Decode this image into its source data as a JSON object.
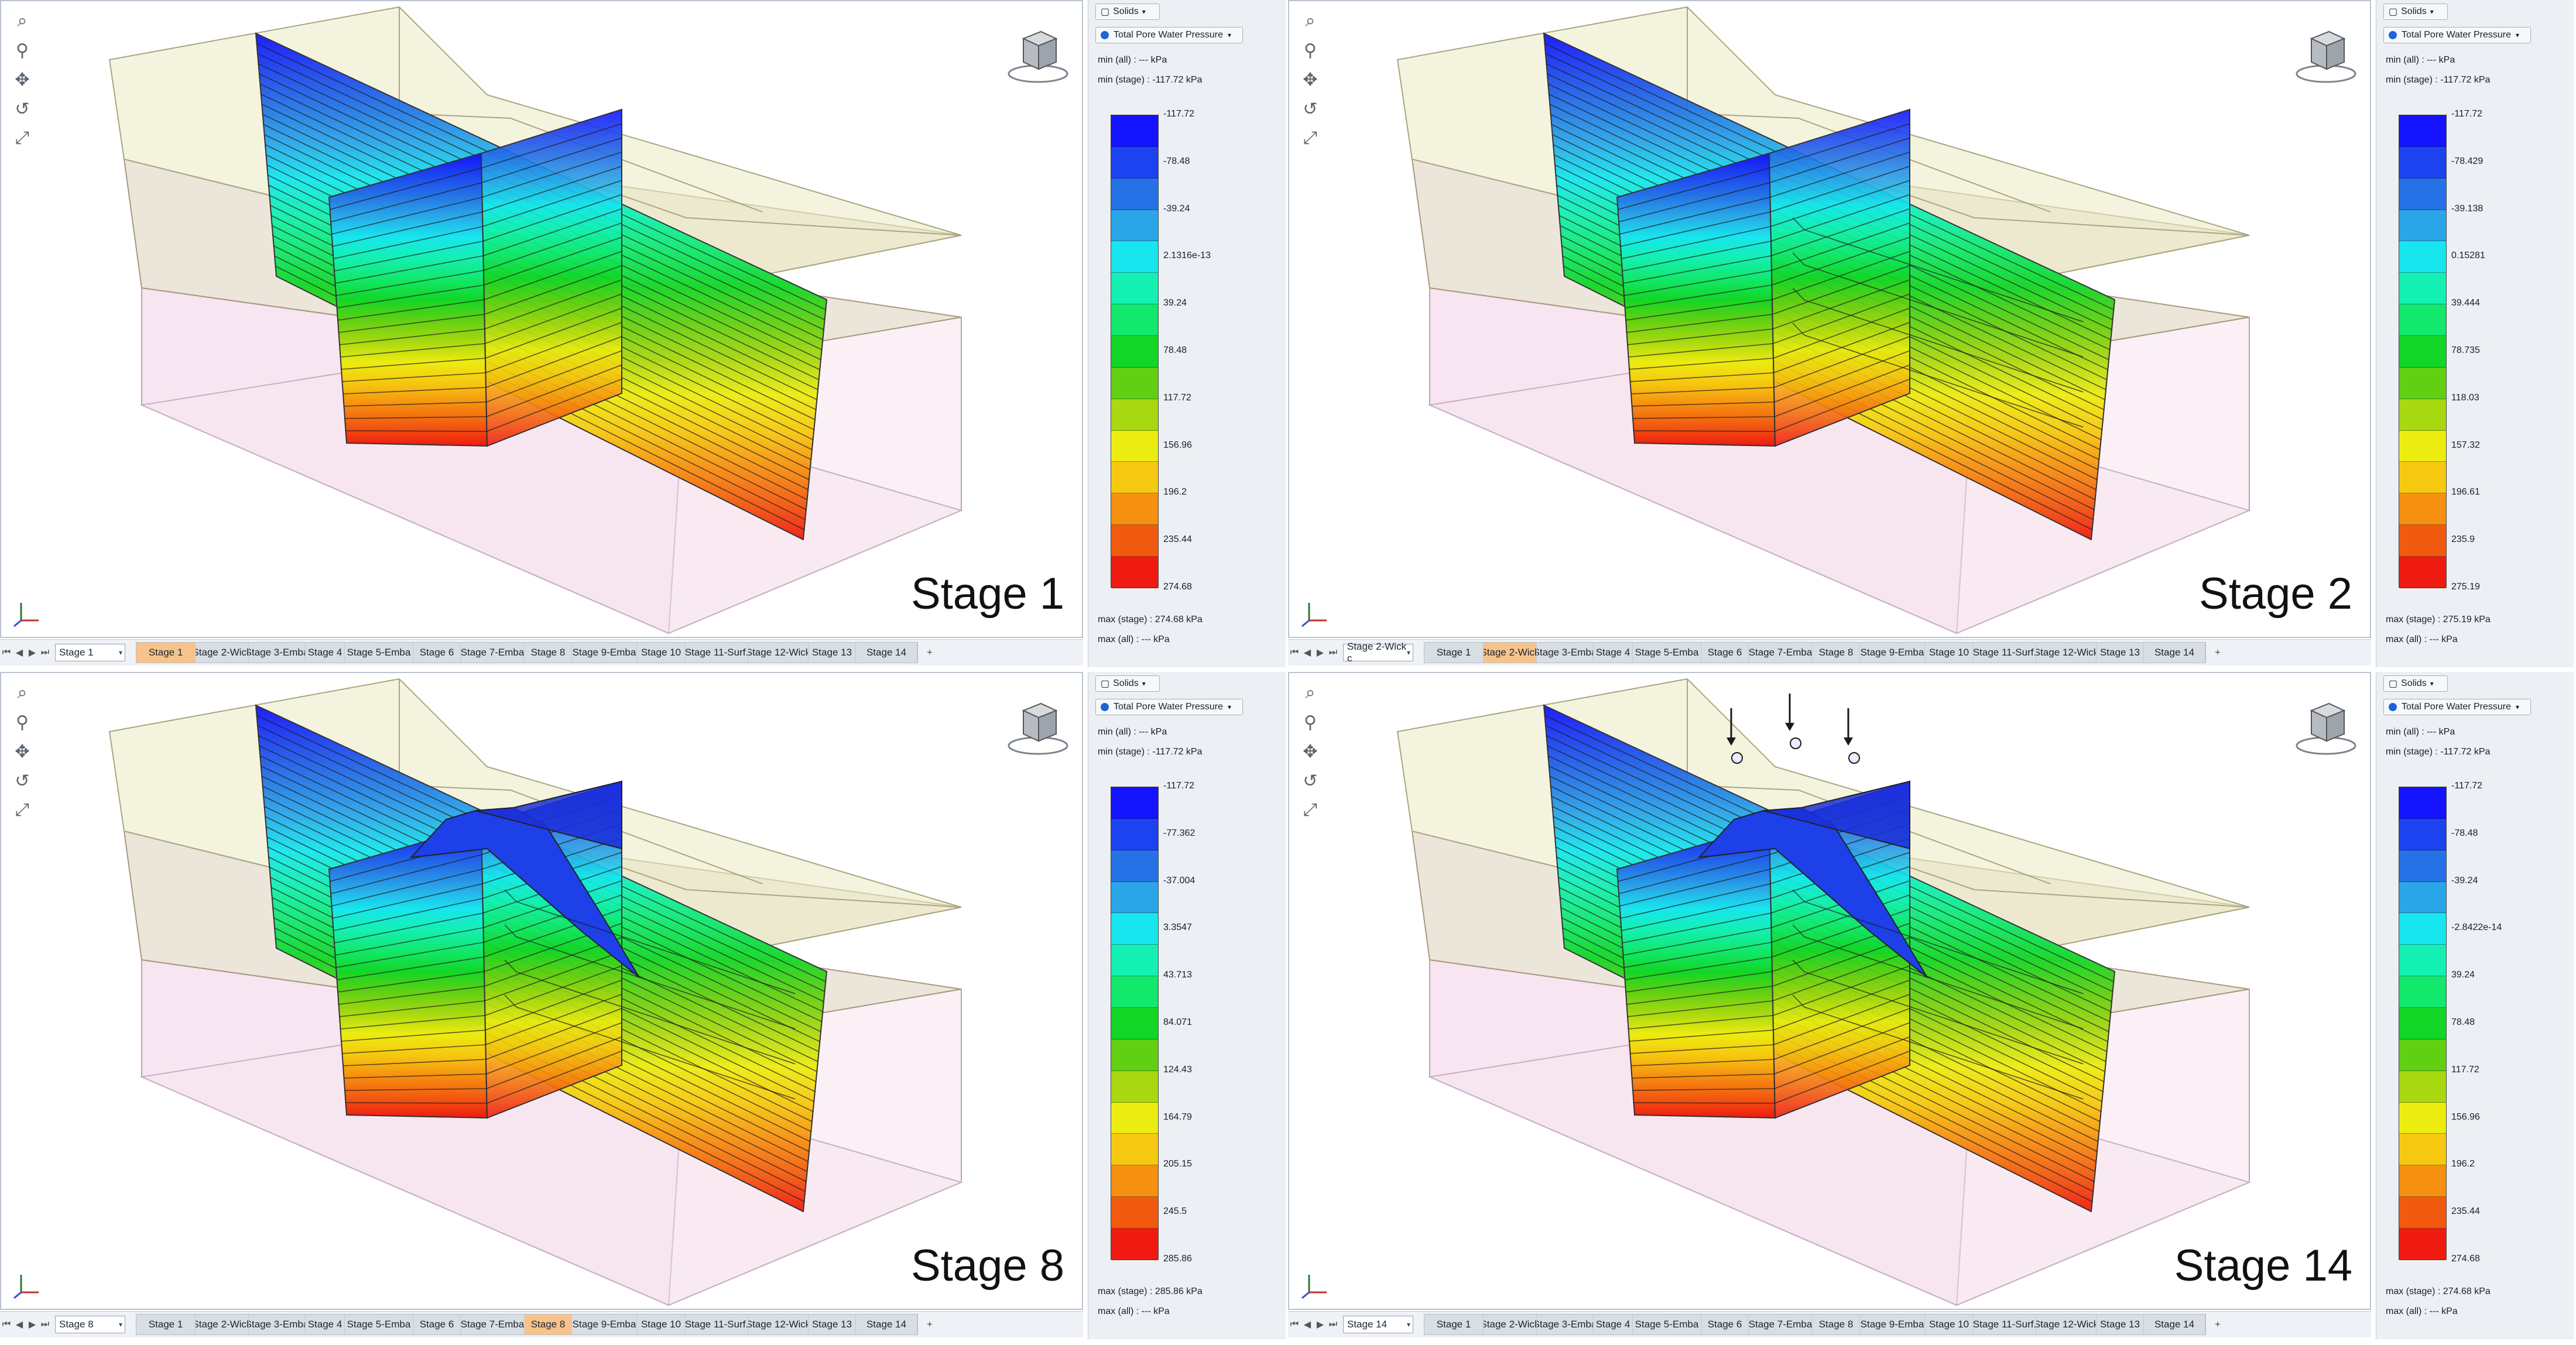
{
  "colors": {
    "bar": [
      "#1414ff",
      "#1d42f0",
      "#2472e6",
      "#2aa6e8",
      "#17e6ee",
      "#14f0b2",
      "#12e86c",
      "#12d626",
      "#62d012",
      "#a8d810",
      "#ecec10",
      "#f6c810",
      "#f69010",
      "#f25a10",
      "#ef1b10"
    ]
  },
  "panels": [
    {
      "stage_label": "Stage 1",
      "stage_input": "Stage 1",
      "active_tab": 0,
      "solids": "Solids",
      "result_type": "Total Pore Water Pressure",
      "min_all": "min (all) :      --- kPa",
      "min_stage": "min (stage) : -117.72 kPa",
      "max_stage": "max (stage) : 274.68 kPa",
      "max_all": "max (all) :      --- kPa",
      "ticks": [
        "-117.72",
        "-78.48",
        "-39.24",
        "2.1316e-13",
        "39.24",
        "78.48",
        "117.72",
        "156.96",
        "196.2",
        "235.44",
        "274.68"
      ],
      "embankment": false,
      "loads": false
    },
    {
      "stage_label": "Stage 2",
      "stage_input": "Stage 2-Wick c",
      "active_tab": 1,
      "solids": "Solids",
      "result_type": "Total Pore Water Pressure",
      "min_all": "min (all) :      --- kPa",
      "min_stage": "min (stage) : -117.72 kPa",
      "max_stage": "max (stage) : 275.19 kPa",
      "max_all": "max (all) :      --- kPa",
      "ticks": [
        "-117.72",
        "-78.429",
        "-39.138",
        "0.15281",
        "39.444",
        "78.735",
        "118.03",
        "157.32",
        "196.61",
        "235.9",
        "275.19"
      ],
      "embankment": false,
      "loads": false
    },
    {
      "stage_label": "Stage 8",
      "stage_input": "Stage 8",
      "active_tab": 7,
      "solids": "Solids",
      "result_type": "Total Pore Water Pressure",
      "min_all": "min (all) :      --- kPa",
      "min_stage": "min (stage) : -117.72 kPa",
      "max_stage": "max (stage) : 285.86 kPa",
      "max_all": "max (all) :      --- kPa",
      "ticks": [
        "-117.72",
        "-77.362",
        "-37.004",
        "3.3547",
        "43.713",
        "84.071",
        "124.43",
        "164.79",
        "205.15",
        "245.5",
        "285.86"
      ],
      "embankment": true,
      "loads": false
    },
    {
      "stage_label": "Stage 14",
      "stage_input": "Stage 14",
      "active_tab": 14,
      "solids": "Solids",
      "result_type": "Total Pore Water Pressure",
      "min_all": "min (all) :      --- kPa",
      "min_stage": "min (stage) : -117.72 kPa",
      "max_stage": "max (stage) : 274.68 kPa",
      "max_all": "max (all) :      --- kPa",
      "ticks": [
        "-117.72",
        "-78.48",
        "-39.24",
        "-2.8422e-14",
        "39.24",
        "78.48",
        "117.72",
        "156.96",
        "196.2",
        "235.44",
        "274.68"
      ],
      "embankment": true,
      "loads": true
    }
  ],
  "tabs": [
    "Stage 1",
    "Stage 2-Wick",
    "Stage 3-Emba",
    "Stage 4",
    "Stage 5-Emba",
    "Stage 6",
    "Stage 7-Emba",
    "Stage 8",
    "Stage 9-Emba",
    "Stage 10",
    "Stage 11-Surf.",
    "Stage 12-Wick",
    "Stage 13",
    "Stage 14"
  ],
  "icons": [
    "zoom-box-icon",
    "zoom-icon",
    "pan-icon",
    "rotate-icon",
    "fit-extents-icon"
  ]
}
